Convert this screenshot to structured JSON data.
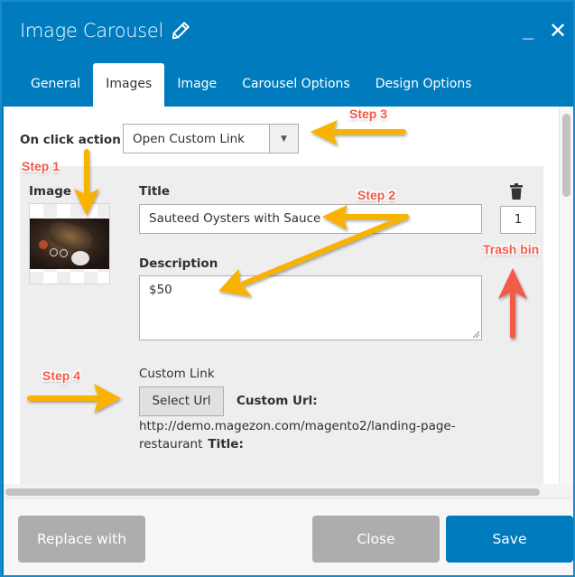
{
  "window": {
    "title": "Image Carousel",
    "title_icon": "pencil-icon",
    "minimize_label": "_",
    "close_label": "✕"
  },
  "tabs": [
    {
      "label": "General",
      "active": false
    },
    {
      "label": "Images",
      "active": true
    },
    {
      "label": "Image",
      "active": false
    },
    {
      "label": "Carousel Options",
      "active": false
    },
    {
      "label": "Design Options",
      "active": false
    }
  ],
  "form": {
    "on_click_label": "On click action",
    "on_click_value": "Open Custom Link",
    "dropdown_icon": "▼",
    "item": {
      "image_label": "Image",
      "title_label": "Title",
      "title_value": "Sauteed Oysters with Sauce",
      "description_label": "Description",
      "description_value": "$50",
      "position_value": "1",
      "trash_icon": "trash-icon",
      "custom_link_label": "Custom Link",
      "select_url_label": "Select Url",
      "custom_url_label": "Custom Url:",
      "custom_url_value": "http://demo.magezon.com/magento2/landing-page-restaurant",
      "link_title_label": "Title:"
    }
  },
  "footer": {
    "replace_label": "Replace with",
    "close_label": "Close",
    "save_label": "Save"
  },
  "annotations": {
    "step1": "Step 1",
    "step2": "Step 2",
    "step3": "Step 3",
    "step4": "Step 4",
    "trash_bin": "Trash bin"
  },
  "colors": {
    "brand_blue": "#007bbd",
    "button_gray": "#adadad",
    "annotation_red": "#f25a4a",
    "arrow_yellow": "#f9b200"
  }
}
